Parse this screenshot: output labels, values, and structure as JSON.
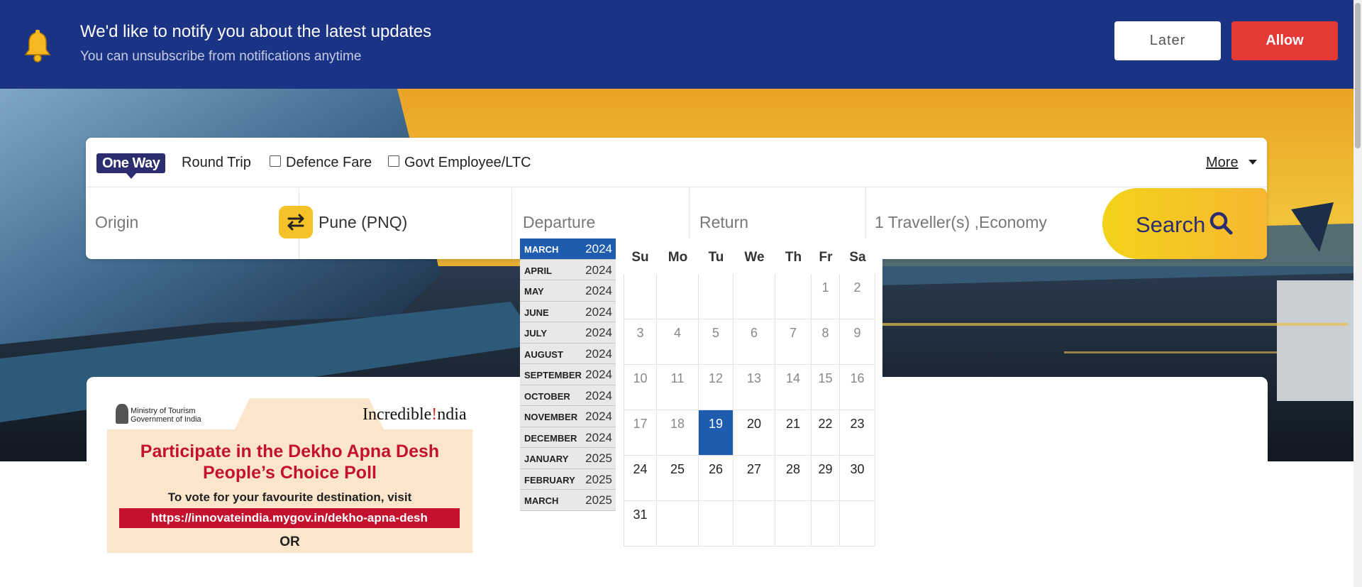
{
  "notification": {
    "title": "We'd like to notify you about the latest updates",
    "subtitle": "You can unsubscribe from notifications anytime",
    "later_label": "Later",
    "allow_label": "Allow",
    "icon": "bell-icon"
  },
  "search_panel": {
    "trip_types": {
      "one_way": "One Way",
      "round_trip": "Round Trip"
    },
    "checkboxes": {
      "defence": "Defence Fare",
      "govt": "Govt Employee/LTC"
    },
    "more_label": "More",
    "origin_placeholder": "Origin",
    "destination_value": "Pune (PNQ)",
    "departure_placeholder": "Departure",
    "return_placeholder": "Return",
    "travellers_value": "1 Traveller(s) ,Economy",
    "search_label": "Search",
    "accent_color": "#f5c229",
    "brand_color": "#2b2d6e"
  },
  "datepicker": {
    "months": [
      {
        "month": "MARCH",
        "year": "2024"
      },
      {
        "month": "APRIL",
        "year": "2024"
      },
      {
        "month": "MAY",
        "year": "2024"
      },
      {
        "month": "JUNE",
        "year": "2024"
      },
      {
        "month": "JULY",
        "year": "2024"
      },
      {
        "month": "AUGUST",
        "year": "2024"
      },
      {
        "month": "SEPTEMBER",
        "year": "2024"
      },
      {
        "month": "OCTOBER",
        "year": "2024"
      },
      {
        "month": "NOVEMBER",
        "year": "2024"
      },
      {
        "month": "DECEMBER",
        "year": "2024"
      },
      {
        "month": "JANUARY",
        "year": "2025"
      },
      {
        "month": "FEBRUARY",
        "year": "2025"
      },
      {
        "month": "MARCH",
        "year": "2025"
      }
    ],
    "weekdays": [
      "Su",
      "Mo",
      "Tu",
      "We",
      "Th",
      "Fr",
      "Sa"
    ],
    "first_weekday_index": 5,
    "days_in_month": 31,
    "selected_day": 19,
    "selected_color": "#1d5cae"
  },
  "banner": {
    "ministry_line1": "Ministry of Tourism",
    "ministry_line2": "Government of India",
    "brand": "Incredible",
    "brand_mark": "!",
    "brand_suffix": "ndia",
    "title_line1": "Participate in the Dekho Apna Desh",
    "title_line2": "People’s Choice Poll",
    "vote_text": "To vote for your favourite destination, visit",
    "url": "https://innovateindia.mygov.in/dekho-apna-desh",
    "or_text": "OR"
  }
}
